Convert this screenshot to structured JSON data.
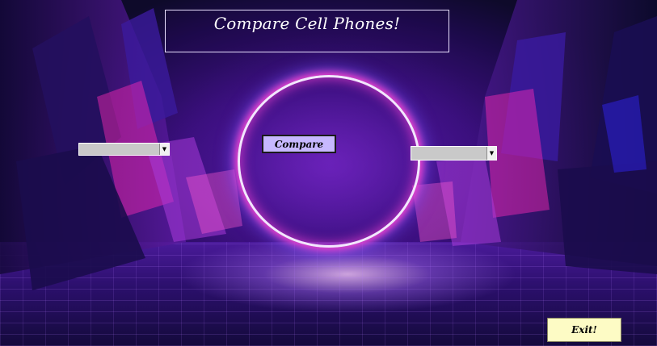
{
  "title": "Compare Cell Phones!",
  "left_select": {
    "value": ""
  },
  "right_select": {
    "value": ""
  },
  "buttons": {
    "compare_label": "Compare",
    "exit_label": "Exit!"
  },
  "icons": {
    "dropdown": "chevron-down-icon"
  },
  "colors": {
    "compare_button_bg": "#c7b8ff",
    "exit_button_bg": "#fdfbc5",
    "ring_glow": "#ff3fc8"
  }
}
